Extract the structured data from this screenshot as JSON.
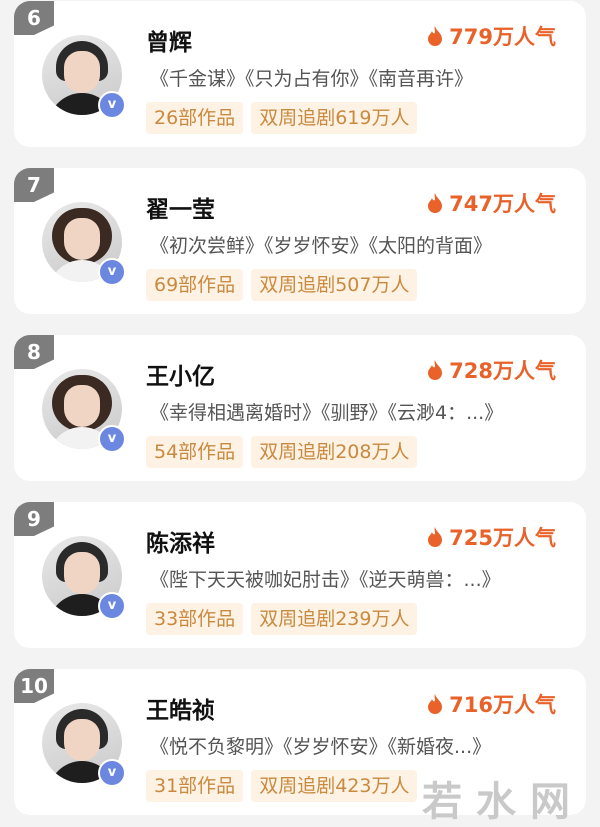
{
  "list": [
    {
      "rank": "6",
      "name": "曾辉",
      "popularity": "779万人气",
      "works": "《千金谋》《只为占有你》《南音再许》",
      "count": "26部作品",
      "chase": "双周追剧619万人"
    },
    {
      "rank": "7",
      "name": "翟一莹",
      "popularity": "747万人气",
      "works": "《初次尝鲜》《岁岁怀安》《太阳的背面》",
      "count": "69部作品",
      "chase": "双周追剧507万人"
    },
    {
      "rank": "8",
      "name": "王小亿",
      "popularity": "728万人气",
      "works": "《幸得相遇离婚时》《驯野》《云渺4：...》",
      "count": "54部作品",
      "chase": "双周追剧208万人"
    },
    {
      "rank": "9",
      "name": "陈添祥",
      "popularity": "725万人气",
      "works": "《陛下天天被咖妃肘击》《逆天萌兽：...》",
      "count": "33部作品",
      "chase": "双周追剧239万人"
    },
    {
      "rank": "10",
      "name": "王皓祯",
      "popularity": "716万人气",
      "works": "《悦不负黎明》《岁岁怀安》《新婚夜...》",
      "count": "31部作品",
      "chase": "双周追剧423万人"
    }
  ],
  "icons": {
    "popularity": "flame-icon",
    "verified": "verified-v-icon"
  },
  "colors": {
    "accent": "#e8622a",
    "tag_bg": "#fdf2e3",
    "tag_text": "#c98a40",
    "rank_bg": "#7d7d7d",
    "verify": "#6b87e0"
  },
  "watermark": "若水网"
}
